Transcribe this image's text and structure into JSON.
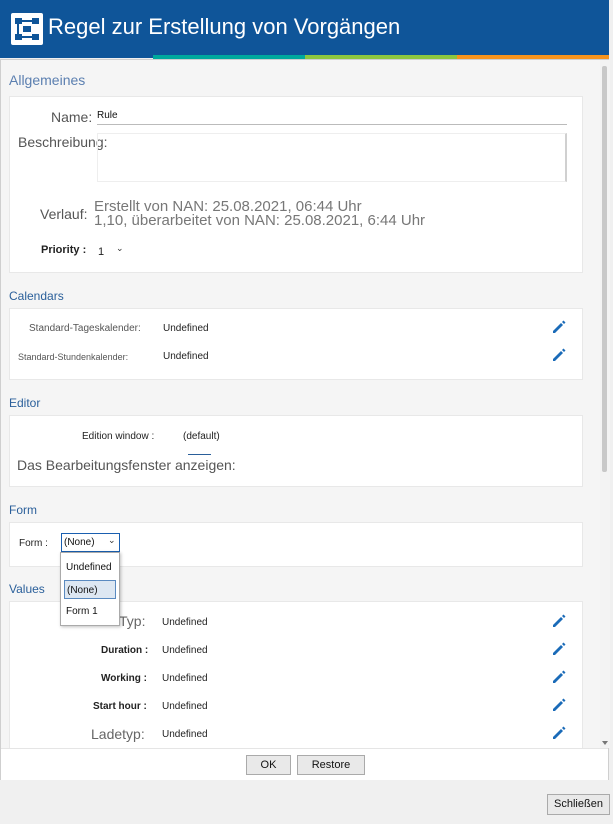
{
  "header": {
    "title": "Regel zur Erstellung von Vorgängen",
    "bg_color": "#0f5599",
    "stripe_colors": [
      "#00a99d",
      "#8cc63f",
      "#f7941d"
    ]
  },
  "general": {
    "section_title": "Allgemeines",
    "name_label": "Name:",
    "name_value": "Rule",
    "description_label": "Beschreibung:",
    "description_value": "",
    "history_label": "Verlauf:",
    "history_line1": "Erstellt von NAN: 25.08.2021, 06:44 Uhr",
    "history_line2": "1,10, überarbeitet von NAN: 25.08.2021, 6:44 Uhr",
    "priority_label": "Priority :",
    "priority_value": "1"
  },
  "calendars": {
    "section_title": "Calendars",
    "rows": [
      {
        "label": "Standard-Tageskalender:",
        "value": "Undefined"
      },
      {
        "label": "Standard-Stundenkalender:",
        "value": "Undefined"
      }
    ]
  },
  "editor": {
    "section_title": "Editor",
    "edition_window_label": "Edition window :",
    "edition_window_value": "(default)",
    "show_editor_label": "Das Bearbeitungsfenster anzeigen:"
  },
  "form": {
    "section_title": "Form",
    "form_label": "Form :",
    "selected": "(None)",
    "options": [
      "Undefined",
      "(None)",
      "Form 1"
    ]
  },
  "values": {
    "section_title": "Values",
    "rows": [
      {
        "label": "Typ:",
        "value": "Undefined"
      },
      {
        "label": "Duration :",
        "value": "Undefined"
      },
      {
        "label": "Working :",
        "value": "Undefined"
      },
      {
        "label": "Start hour :",
        "value": "Undefined"
      },
      {
        "label": "Ladetyp:",
        "value": "Undefined"
      }
    ]
  },
  "footer": {
    "ok_label": "OK",
    "restore_label": "Restore"
  },
  "close_label": "Schließen"
}
